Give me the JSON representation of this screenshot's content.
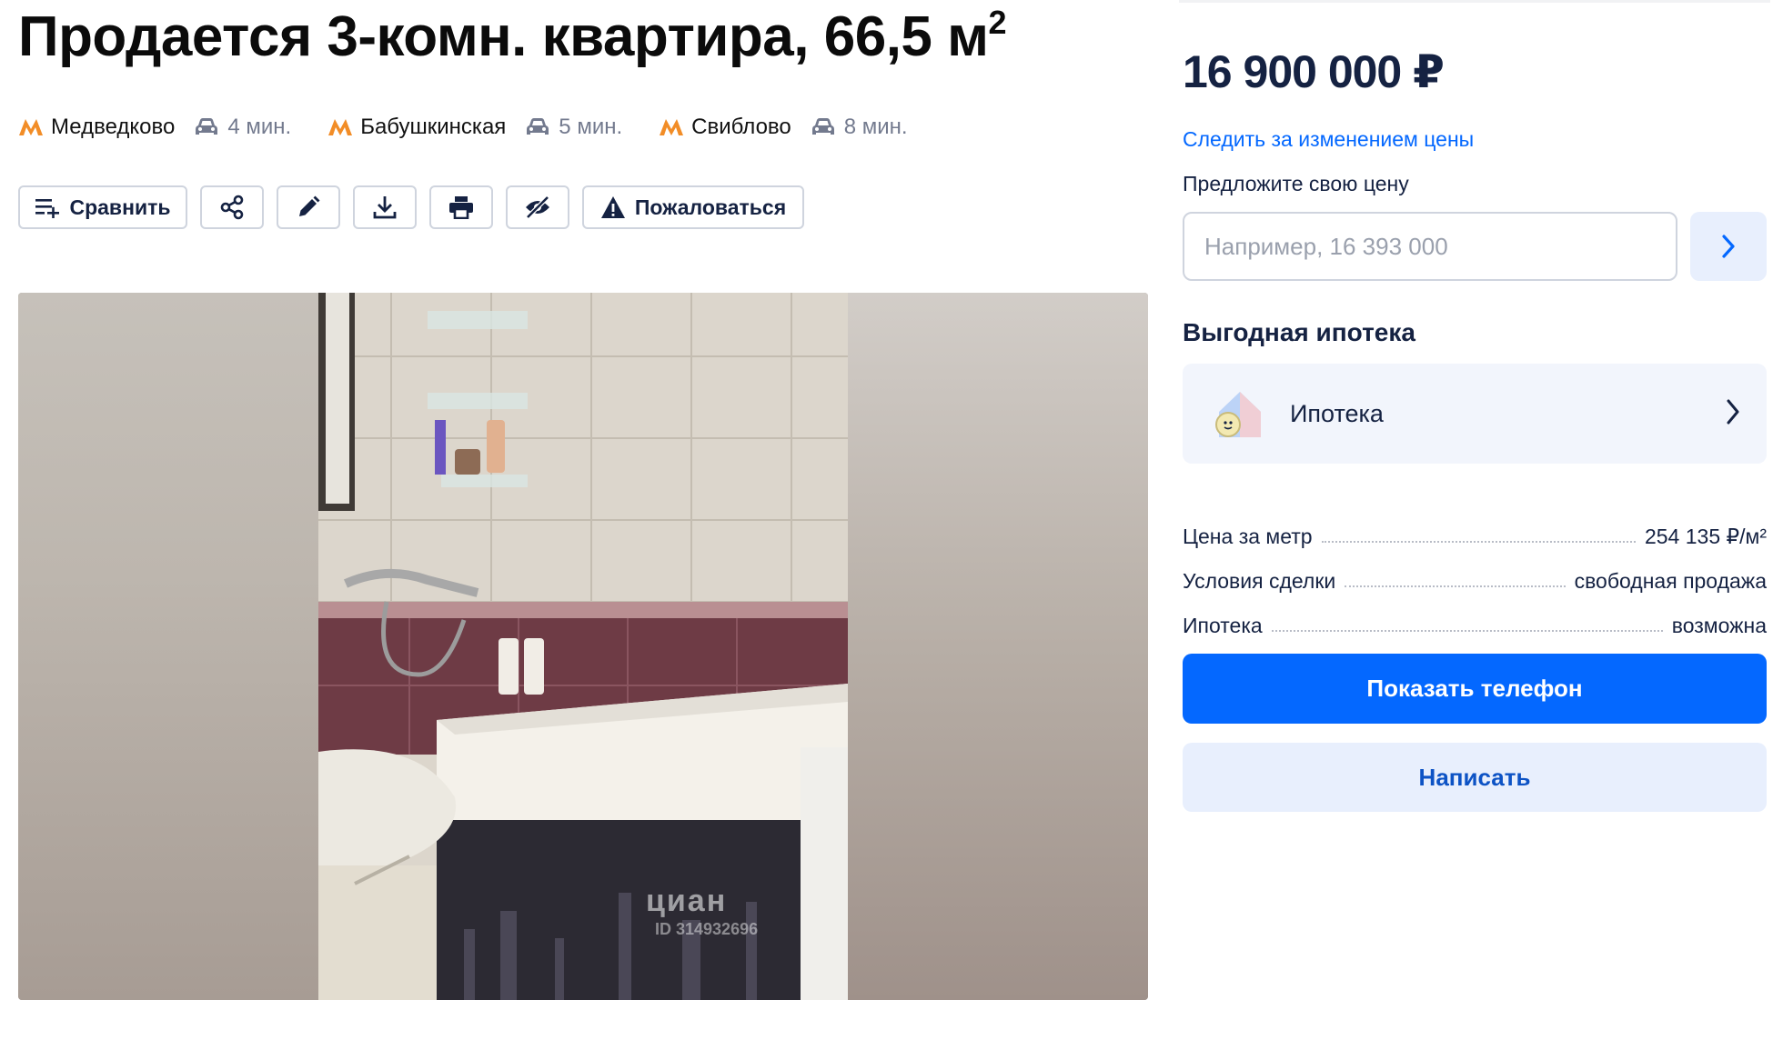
{
  "listing": {
    "title": "Продается 3-комн. квартира, 66,5 м",
    "title_sup": "2"
  },
  "metro": [
    {
      "station": "Медведково",
      "time": "4 мин.",
      "icon": "metro-m-icon",
      "transport_icon": "car-icon"
    },
    {
      "station": "Бабушкинская",
      "time": "5 мин.",
      "icon": "metro-m-icon",
      "transport_icon": "car-icon"
    },
    {
      "station": "Свиблово",
      "time": "8 мин.",
      "icon": "metro-m-icon",
      "transport_icon": "car-icon"
    }
  ],
  "actions": {
    "compare_label": "Сравнить",
    "report_label": "Пожаловаться",
    "icons": [
      "share-icon",
      "edit-icon",
      "download-icon",
      "print-icon",
      "hide-icon"
    ]
  },
  "photo": {
    "watermark": "циан",
    "watermark_id": "ID 314932696"
  },
  "sidebar": {
    "price": "16 900 000 ₽",
    "watch_price_link": "Следить за изменением цены",
    "offer_label": "Предложите свою цену",
    "offer_placeholder": "Например, 16 393 000",
    "mortgage_heading": "Выгодная ипотека",
    "mortgage_card_label": "Ипотека",
    "facts": [
      {
        "key": "Цена за метр",
        "value": "254 135 ₽/м²"
      },
      {
        "key": "Условия сделки",
        "value": "свободная продажа"
      },
      {
        "key": "Ипотека",
        "value": "возможна"
      }
    ],
    "show_phone_label": "Показать телефон",
    "write_label": "Написать"
  },
  "colors": {
    "accent": "#0468ff",
    "accent_light": "#e8effd",
    "text": "#152242",
    "metro": "#f28d27"
  }
}
